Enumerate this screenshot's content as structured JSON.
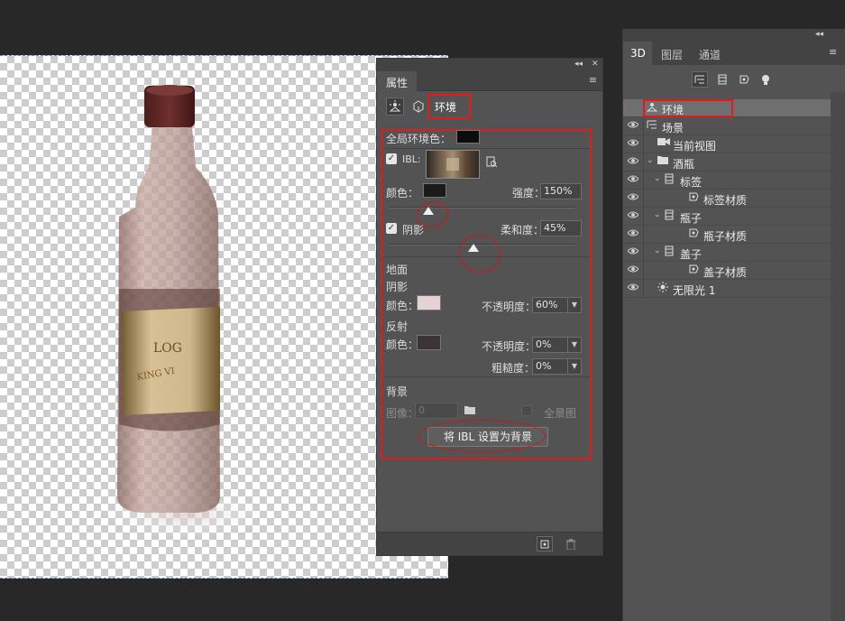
{
  "properties_panel": {
    "title": "属性",
    "type_tab": "环境",
    "global_ambient_label": "全局环境色：",
    "global_ambient_color": "#0c0c0c",
    "ibl_label": "IBL:",
    "ibl_checked": true,
    "color_label": "颜色：",
    "ibl_color": "#1b1b1b",
    "intensity_label": "强度：",
    "intensity_value": "150%",
    "shadow_label": "阴影",
    "shadow_checked": true,
    "softness_label": "柔和度：",
    "softness_value": "45%",
    "ground_label": "地面",
    "ground_shadow_label": "阴影",
    "ground_shadow_color_label": "颜色：",
    "ground_shadow_color": "#e5d2d4",
    "opacity_label": "不透明度：",
    "ground_shadow_opacity": "60%",
    "reflection_label": "反射",
    "reflection_color_label": "颜色：",
    "reflection_color": "#3d3435",
    "reflection_opacity_label": "不透明度：",
    "reflection_opacity": "0%",
    "roughness_label": "粗糙度：",
    "roughness_value": "0%",
    "background_label": "背景",
    "image_label": "图像：",
    "image_value": "0",
    "panorama_label": "全景图",
    "set_bg_button": "将 IBL 设置为背景"
  },
  "panel_3d": {
    "tabs": [
      "3D",
      "图层",
      "通道"
    ],
    "active_tab": "3D",
    "layers": [
      {
        "name": "环境",
        "icon": "environment-icon",
        "indent": 0,
        "selected": true,
        "eye": false,
        "expander": false
      },
      {
        "name": "场景",
        "icon": "scene-icon",
        "indent": 0,
        "selected": false,
        "eye": true,
        "expander": false
      },
      {
        "name": "当前视图",
        "icon": "camera-icon",
        "indent": 1,
        "selected": false,
        "eye": true,
        "expander": false
      },
      {
        "name": "酒瓶",
        "icon": "folder-icon",
        "indent": 1,
        "selected": false,
        "eye": true,
        "expander": true
      },
      {
        "name": "标签",
        "icon": "mesh-icon",
        "indent": 2,
        "selected": false,
        "eye": true,
        "expander": true
      },
      {
        "name": "标签材质",
        "icon": "material-icon",
        "indent": 3,
        "selected": false,
        "eye": true,
        "expander": false
      },
      {
        "name": "瓶子",
        "icon": "mesh-icon",
        "indent": 2,
        "selected": false,
        "eye": true,
        "expander": true
      },
      {
        "name": "瓶子材质",
        "icon": "material-icon",
        "indent": 3,
        "selected": false,
        "eye": true,
        "expander": false
      },
      {
        "name": "盖子",
        "icon": "mesh-icon",
        "indent": 2,
        "selected": false,
        "eye": true,
        "expander": true
      },
      {
        "name": "盖子材质",
        "icon": "material-icon",
        "indent": 3,
        "selected": false,
        "eye": true,
        "expander": false
      },
      {
        "name": "无限光 1",
        "icon": "sun-icon",
        "indent": 1,
        "selected": false,
        "eye": true,
        "expander": false
      }
    ]
  },
  "canvas": {
    "bottle_label_text_1": "LOG",
    "bottle_label_text_2": "KING VI"
  }
}
